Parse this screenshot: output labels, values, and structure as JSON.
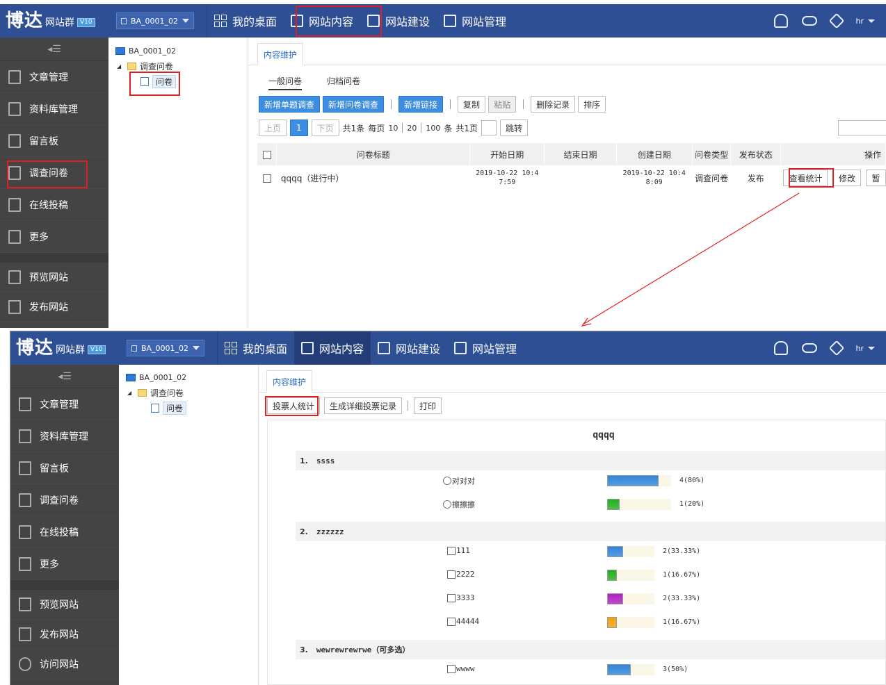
{
  "brand": {
    "logo_big": "博达",
    "logo_small": "网站群",
    "version": "V10"
  },
  "site_selector": "BA_0001_02",
  "nav": [
    "我的桌面",
    "网站内容",
    "网站建设",
    "网站管理"
  ],
  "user": "hr",
  "sidebar_collapse": "◂☰",
  "sidebar": {
    "items": [
      "文章管理",
      "资料库管理",
      "留言板",
      "调查问卷",
      "在线投稿",
      "更多"
    ],
    "bottom": [
      "预览网站",
      "发布网站",
      "访问网站"
    ]
  },
  "tree": {
    "root": "BA_0001_02",
    "folder": "调查问卷",
    "leaf": "问卷"
  },
  "tab_label": "内容维护",
  "top": {
    "subtabs": [
      "一般问卷",
      "归档问卷"
    ],
    "toolbar": [
      "新增单题调查",
      "新增问卷调查",
      "新增链接",
      "复制",
      "粘贴",
      "删除记录",
      "排序"
    ],
    "pager": {
      "prev": "上页",
      "page": "1",
      "next": "下页",
      "total": "共1条",
      "per_page_label": "每页",
      "sizes": [
        "10",
        "20",
        "100"
      ],
      "unit": "条",
      "pages": "共1页",
      "jump": "跳转"
    },
    "columns": [
      "问卷标题",
      "开始日期",
      "结束日期",
      "创建日期",
      "问卷类型",
      "发布状态",
      "操作"
    ],
    "row": {
      "title": "qqqq（进行中）",
      "start_date": "2019-10-22 10:47:59",
      "start_line1": "2019-10-22 10:4",
      "start_line2": "7:59",
      "end_date": "",
      "created_line1": "2019-10-22 10:4",
      "created_line2": "8:09",
      "type": "调查问卷",
      "status": "发布",
      "actions": [
        "查看统计",
        "修改",
        "暂"
      ]
    }
  },
  "bottom": {
    "toolbar": [
      "投票人统计",
      "生成详细投票记录",
      "打印"
    ],
    "survey_title": "qqqq",
    "questions": [
      {
        "num": "1.",
        "title": "ssss",
        "kind": "radio",
        "options": [
          {
            "label": "对对对",
            "count": "4(80%)",
            "ratio": 0.8,
            "color": "#2f86dc"
          },
          {
            "label": "擦擦擦",
            "count": "1(20%)",
            "ratio": 0.2,
            "color": "#22b022"
          }
        ]
      },
      {
        "num": "2.",
        "title": "zzzzzz",
        "kind": "checkbox",
        "options": [
          {
            "label": "111",
            "count": "2(33.33%)",
            "ratio": 0.3333,
            "color": "#2f86dc"
          },
          {
            "label": "2222",
            "count": "1(16.67%)",
            "ratio": 0.1667,
            "color": "#22b022"
          },
          {
            "label": "3333",
            "count": "2(33.33%)",
            "ratio": 0.3333,
            "color": "#b020c0"
          },
          {
            "label": "44444",
            "count": "1(16.67%)",
            "ratio": 0.1667,
            "color": "#f0a010"
          }
        ]
      },
      {
        "num": "3.",
        "title": "wewrewrewrwe（可多选）",
        "kind": "checkbox",
        "options": [
          {
            "label": "wwww",
            "count": "3(50%)",
            "ratio": 0.5,
            "color": "#2f86dc"
          }
        ]
      }
    ]
  }
}
